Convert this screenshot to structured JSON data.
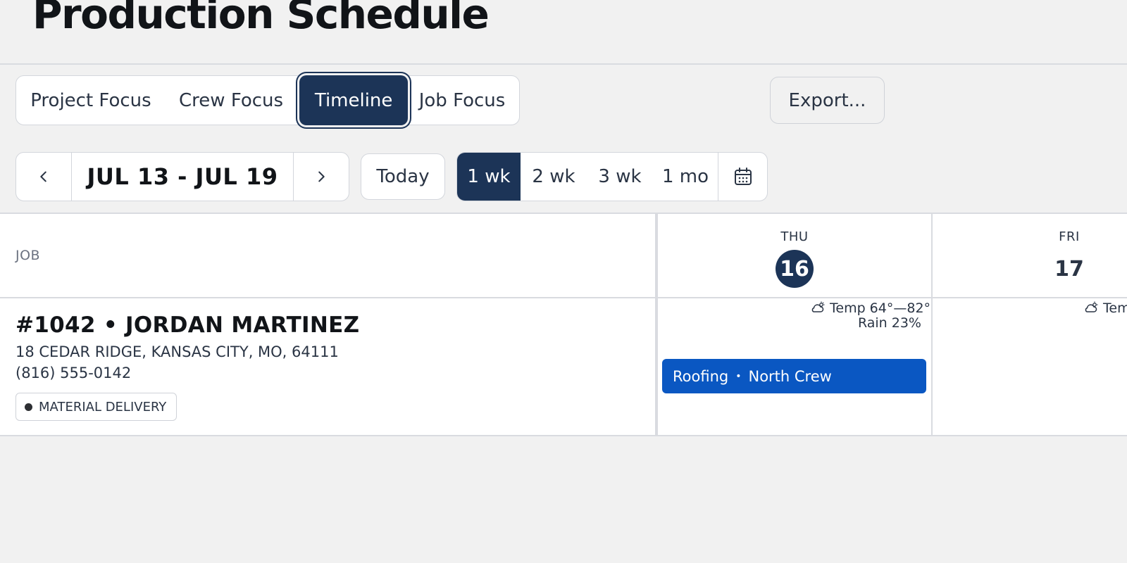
{
  "page": {
    "title": "Production Schedule"
  },
  "view_tabs": [
    {
      "label": "Project Focus",
      "active": false
    },
    {
      "label": "Crew Focus",
      "active": false
    },
    {
      "label": "Timeline",
      "active": true
    },
    {
      "label": "Job Focus",
      "active": false
    }
  ],
  "toolbar": {
    "export_label": "Export..."
  },
  "date_nav": {
    "range": "JUL 13 - JUL 19",
    "prev_icon": "chevron-left-icon",
    "next_icon": "chevron-right-icon",
    "today_label": "Today"
  },
  "range_tabs": [
    {
      "label": "1 wk",
      "active": true
    },
    {
      "label": "2 wk",
      "active": false
    },
    {
      "label": "3 wk",
      "active": false
    },
    {
      "label": "1 mo",
      "active": false
    }
  ],
  "calendar_icon": "calendar-icon",
  "grid": {
    "job_column_label": "JOB",
    "days": [
      {
        "name": "THU",
        "number": "16",
        "today": true
      },
      {
        "name": "FRI",
        "number": "17",
        "today": false
      }
    ]
  },
  "job": {
    "title": "#1042 • JORDAN MARTINEZ",
    "address": "18 CEDAR RIDGE, KANSAS CITY, MO, 64111",
    "phone": "(816) 555-0142",
    "badge": "MATERIAL DELIVERY"
  },
  "weather": {
    "thu": {
      "temp": "Temp 64°—82°",
      "rain": "Rain 23%",
      "icon": "partly-cloudy-icon"
    },
    "fri": {
      "temp": "Tem",
      "icon": "partly-cloudy-icon"
    }
  },
  "event": {
    "trade": "Roofing",
    "separator": "•",
    "crew": "North Crew",
    "color": "#0a57c2"
  },
  "colors": {
    "primary": "#1c3457",
    "event_blue": "#0a57c2",
    "background": "#f1f1f1"
  }
}
